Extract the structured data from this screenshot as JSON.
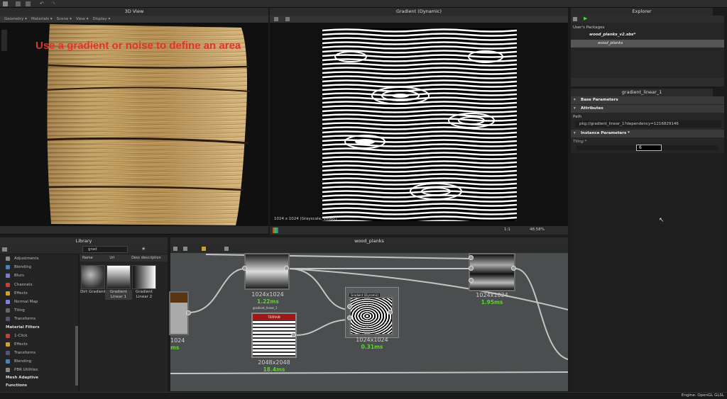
{
  "view3d": {
    "title": "3D View",
    "menu": [
      "Geometry ▾",
      "Materials ▾",
      "Scene ▾",
      "View ▾",
      "Display ▾"
    ],
    "annotation": "Use a gradient or noise to define an area"
  },
  "view2d": {
    "title": "Gradient (Dynamic)",
    "status": "1024 x 1024 (Grayscale, 16bpc)",
    "zoom": "48.58%",
    "ratio": "1:1"
  },
  "explorer": {
    "title": "Explorer",
    "section": "User's Packages",
    "package": "wood_planks_v2.sbs*",
    "graph": "wood_planks"
  },
  "params": {
    "title": "gradient_linear_1",
    "base": "Base Parameters",
    "attributes": "Attributes",
    "path_label": "Path",
    "path_value": "pkg://gradient_linear_1?dependency=1216829146",
    "instance": "Instance Parameters *",
    "tiling_label": "Tiling *",
    "tiling_value": "6"
  },
  "library": {
    "title": "Library",
    "search": "grad",
    "col_name": "Name",
    "col_url": "Url",
    "col_desc": "Desc description",
    "items": [
      "Adjustments",
      "Blending",
      "Blurs",
      "Channels",
      "Effects",
      "Normal Map",
      "Tiling",
      "Transforms"
    ],
    "section_filters": "Material Filters",
    "filters": [
      "1-Click",
      "Effects",
      "Transforms",
      "Blending",
      "PBR Utilities"
    ],
    "section_mesh": "Mesh Adaptive",
    "section_functions": "Functions",
    "tiles": [
      "Dirt Gradient",
      "Gradient Linear 1",
      "Gradient Linear 2"
    ]
  },
  "graph": {
    "title": "wood_planks",
    "nodes": [
      {
        "size": "1024x1024",
        "time": "1.22ms"
      },
      {
        "size": "1024x1024",
        "time": "1.95ms"
      },
      {
        "size": "1024",
        "time": "ms"
      },
      {
        "size": "2048x2048",
        "time": "18.4ms",
        "label": "gradient_linear_1",
        "header": "TERRAIN"
      },
      {
        "size": "1024x1024",
        "time": "0.31ms",
        "label": "Gradient (Dynamic)"
      }
    ]
  },
  "footer": {
    "engine": "Engine: OpenGL GLSL"
  }
}
